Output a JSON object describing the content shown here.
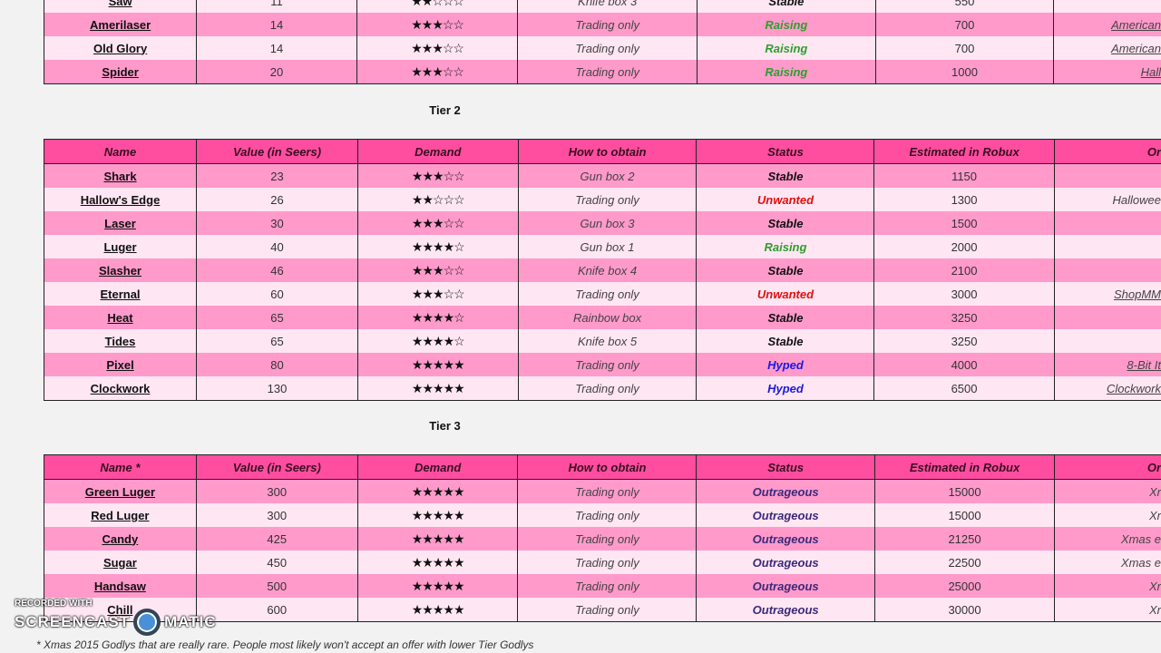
{
  "colors": {
    "header": "#ff4da0",
    "row_dark": "#ff9acb",
    "row_light": "#ffe6f3",
    "Raising": "#2e9e2e",
    "Stable": "#111111",
    "Unwanted": "#e01010",
    "Hyped": "#1a1ae0",
    "Outrageous": "#3b2a7a"
  },
  "columns": [
    "Name",
    "Value (in Seers)",
    "Demand",
    "How to obtain",
    "Status",
    "Estimated in Robux",
    "Or"
  ],
  "tier1": {
    "rows": [
      {
        "name": "Saw",
        "value": "11",
        "demand": 2,
        "how": "Knife box 3",
        "status": "Stable",
        "robux": "550",
        "origin": ""
      },
      {
        "name": "Amerilaser",
        "value": "14",
        "demand": 3,
        "how": "Trading only",
        "status": "Raising",
        "robux": "700",
        "origin": "American"
      },
      {
        "name": "Old Glory",
        "value": "14",
        "demand": 3,
        "how": "Trading only",
        "status": "Raising",
        "robux": "700",
        "origin": "American"
      },
      {
        "name": "Spider",
        "value": "20",
        "demand": 3,
        "how": "Trading only",
        "status": "Raising",
        "robux": "1000",
        "origin": "Hall"
      }
    ]
  },
  "tier2": {
    "title": "Tier 2",
    "rows": [
      {
        "name": "Shark",
        "value": "23",
        "demand": 3,
        "how": "Gun box 2",
        "status": "Stable",
        "robux": "1150",
        "origin": ""
      },
      {
        "name": "Hallow's Edge",
        "value": "26",
        "demand": 2,
        "how": "Trading only",
        "status": "Unwanted",
        "robux": "1300",
        "origin": "Hallowee",
        "plain": true
      },
      {
        "name": "Laser",
        "value": "30",
        "demand": 3,
        "how": "Gun box 3",
        "status": "Stable",
        "robux": "1500",
        "origin": ""
      },
      {
        "name": "Luger",
        "value": "40",
        "demand": 4,
        "how": "Gun box 1",
        "status": "Raising",
        "robux": "2000",
        "origin": ""
      },
      {
        "name": "Slasher",
        "value": "46",
        "demand": 3,
        "how": "Knife box 4",
        "status": "Stable",
        "robux": "2100",
        "origin": ""
      },
      {
        "name": "Eternal",
        "value": "60",
        "demand": 3,
        "how": "Trading only",
        "status": "Unwanted",
        "robux": "3000",
        "origin": "ShopMM"
      },
      {
        "name": "Heat",
        "value": "65",
        "demand": 4,
        "how": "Rainbow box",
        "status": "Stable",
        "robux": "3250",
        "origin": ""
      },
      {
        "name": "Tides",
        "value": "65",
        "demand": 4,
        "how": "Knife box 5",
        "status": "Stable",
        "robux": "3250",
        "origin": ""
      },
      {
        "name": "Pixel",
        "value": "80",
        "demand": 5,
        "how": "Trading only",
        "status": "Hyped",
        "robux": "4000",
        "origin": "8-Bit It"
      },
      {
        "name": "Clockwork",
        "value": "130",
        "demand": 5,
        "how": "Trading only",
        "status": "Hyped",
        "robux": "6500",
        "origin": "Clockwork"
      }
    ]
  },
  "tier3": {
    "title": "Tier 3",
    "name_header": "Name *",
    "rows": [
      {
        "name": "Green Luger",
        "value": "300",
        "demand": 5,
        "how": "Trading only",
        "status": "Outrageous",
        "robux": "15000",
        "origin": "Xr",
        "plain": true
      },
      {
        "name": "Red Luger",
        "value": "300",
        "demand": 5,
        "how": "Trading only",
        "status": "Outrageous",
        "robux": "15000",
        "origin": "Xr",
        "plain": true
      },
      {
        "name": "Candy",
        "value": "425",
        "demand": 5,
        "how": "Trading only",
        "status": "Outrageous",
        "robux": "21250",
        "origin": "Xmas e",
        "plain": true
      },
      {
        "name": "Sugar",
        "value": "450",
        "demand": 5,
        "how": "Trading only",
        "status": "Outrageous",
        "robux": "22500",
        "origin": "Xmas e",
        "plain": true
      },
      {
        "name": "Handsaw",
        "value": "500",
        "demand": 5,
        "how": "Trading only",
        "status": "Outrageous",
        "robux": "25000",
        "origin": "Xr",
        "plain": true
      },
      {
        "name": "Chill",
        "value": "600",
        "demand": 5,
        "how": "Trading only",
        "status": "Outrageous",
        "robux": "30000",
        "origin": "Xr",
        "plain": true
      }
    ]
  },
  "footnote": "* Xmas 2015 Godlys that are really rare. People most likely won't accept an offer with lower Tier Godlys",
  "watermark": {
    "top": "RECORDED WITH",
    "left": "SCREENCAST",
    "right": "MATIC"
  }
}
